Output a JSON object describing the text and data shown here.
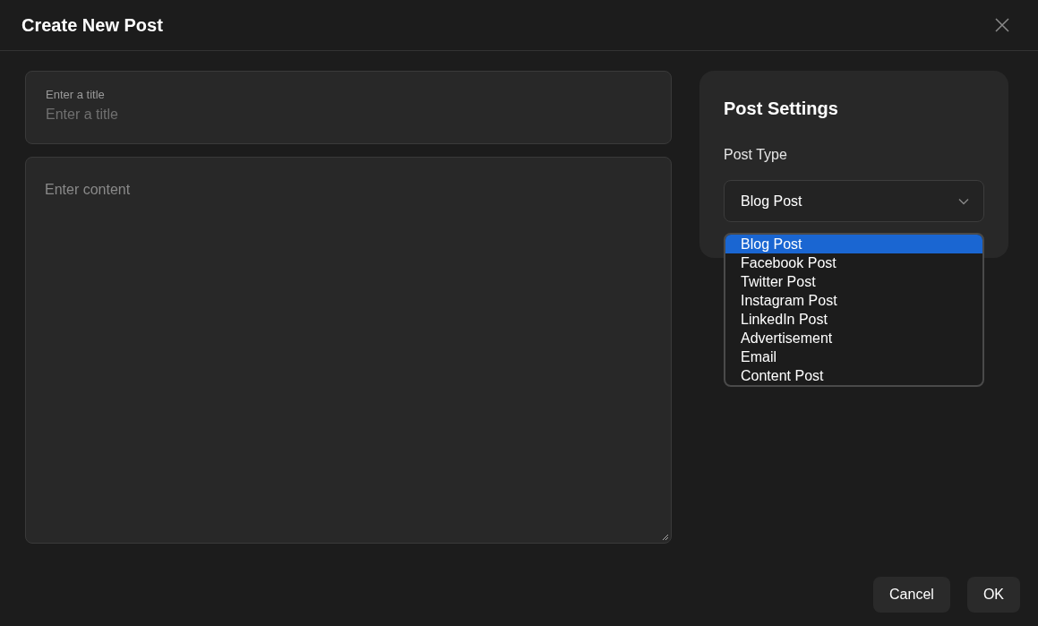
{
  "dialog": {
    "title": "Create New Post"
  },
  "title_field": {
    "label": "Enter a title",
    "placeholder": "Enter a title"
  },
  "content_field": {
    "placeholder": "Enter content"
  },
  "settings": {
    "heading": "Post Settings",
    "post_type": {
      "label": "Post Type",
      "value": "Blog Post",
      "expanded": true,
      "options": [
        {
          "label": "Blog Post",
          "selected": true
        },
        {
          "label": "Facebook Post",
          "selected": false
        },
        {
          "label": "Twitter Post",
          "selected": false
        },
        {
          "label": "Instagram Post",
          "selected": false
        },
        {
          "label": "LinkedIn Post",
          "selected": false
        },
        {
          "label": "Advertisement",
          "selected": false
        },
        {
          "label": "Email",
          "selected": false
        },
        {
          "label": "Content Post",
          "selected": false
        }
      ]
    }
  },
  "buttons": [
    "Cancel",
    "OK"
  ]
}
